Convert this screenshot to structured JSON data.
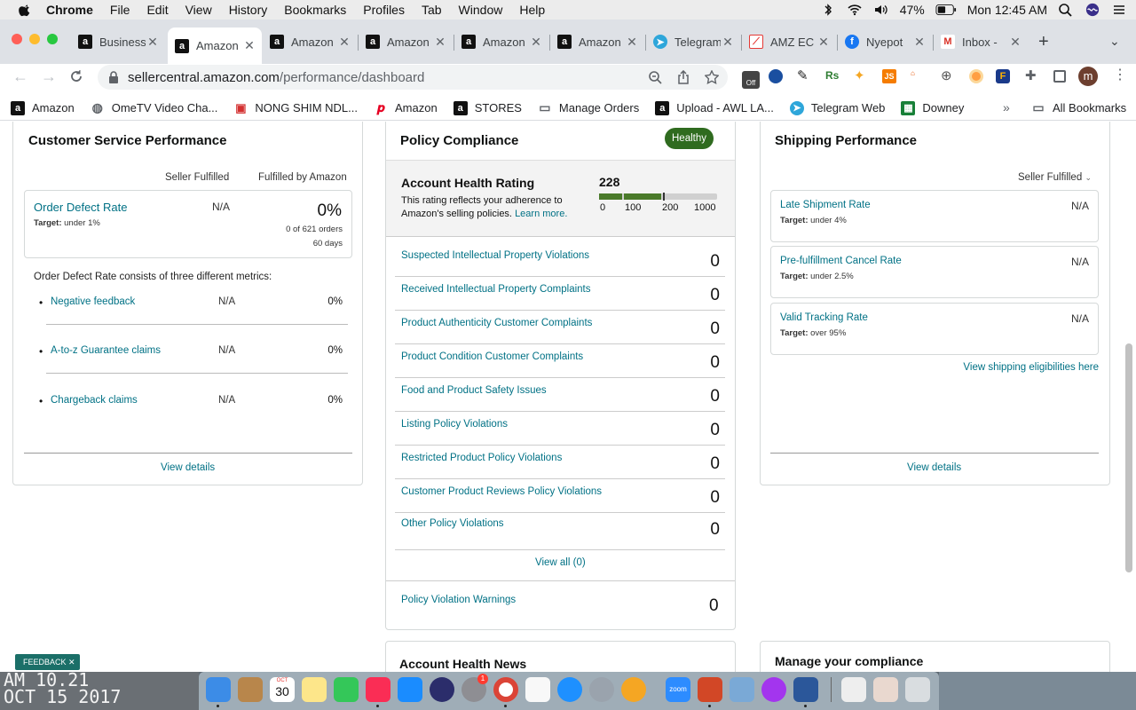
{
  "menubar": {
    "items": [
      "Chrome",
      "File",
      "Edit",
      "View",
      "History",
      "Bookmarks",
      "Profiles",
      "Tab",
      "Window",
      "Help"
    ],
    "battery": "47%",
    "clock": "Mon 12:45 AM"
  },
  "tabs": [
    {
      "title": "Business",
      "icon": "amazon-icon"
    },
    {
      "title": "Amazon",
      "icon": "amazon-icon"
    },
    {
      "title": "Amazon",
      "icon": "amazon-icon"
    },
    {
      "title": "Amazon",
      "icon": "amazon-icon"
    },
    {
      "title": "Amazon",
      "icon": "amazon-icon"
    },
    {
      "title": "Amazon",
      "icon": "amazon-icon"
    },
    {
      "title": "Telegram",
      "icon": "telegram-icon"
    },
    {
      "title": "AMZ EC",
      "icon": "amz-icon"
    },
    {
      "title": "Nyepot",
      "icon": "facebook-icon"
    },
    {
      "title": "Inbox -",
      "icon": "gmail-icon"
    }
  ],
  "address": {
    "domain": "sellercentral.amazon.com",
    "path": "/performance/dashboard"
  },
  "profile_initial": "m",
  "bookmarks": [
    {
      "label": "Amazon",
      "icon": "amazon-icon"
    },
    {
      "label": "OmeTV Video Cha...",
      "icon": "globe-icon"
    },
    {
      "label": "NONG SHIM NDL...",
      "icon": "gift-icon"
    },
    {
      "label": "Amazon",
      "icon": "pinterest-icon"
    },
    {
      "label": "STORES",
      "icon": "amazon-icon"
    },
    {
      "label": "Manage Orders",
      "icon": "folder-icon"
    },
    {
      "label": "Upload - AWL LA...",
      "icon": "amazon-icon"
    },
    {
      "label": "Telegram Web",
      "icon": "telegram-icon"
    },
    {
      "label": "Downey",
      "icon": "sheets-icon"
    }
  ],
  "bookmarks_more": "»",
  "all_bookmarks": "All Bookmarks",
  "customer_service": {
    "title": "Customer Service Performance",
    "col1": "Seller Fulfilled",
    "col2": "Fulfilled by Amazon",
    "odr": {
      "label": "Order Defect Rate",
      "target_label": "Target:",
      "target": "under 1%",
      "seller": "N/A",
      "fba": "0%",
      "orders": "0 of 621 orders",
      "days": "60 days"
    },
    "consists": "Order Defect Rate consists of three different metrics:",
    "metrics": [
      {
        "label": "Negative feedback",
        "seller": "N/A",
        "fba": "0%"
      },
      {
        "label": "A-to-z Guarantee claims",
        "seller": "N/A",
        "fba": "0%"
      },
      {
        "label": "Chargeback claims",
        "seller": "N/A",
        "fba": "0%"
      }
    ],
    "view_details": "View details"
  },
  "policy": {
    "title": "Policy Compliance",
    "badge": "Healthy",
    "badge_color": "#2f6b1f",
    "ahr_title": "Account Health Rating",
    "ahr_desc_1": "This rating reflects your adherence to",
    "ahr_desc_2": "Amazon's selling policies.",
    "learn_more": "Learn more.",
    "score": "228",
    "score_fraction": 0.228,
    "scale": [
      "0",
      "100",
      "200",
      "1000"
    ],
    "rows": [
      {
        "label": "Suspected Intellectual Property Violations",
        "value": "0"
      },
      {
        "label": "Received Intellectual Property Complaints",
        "value": "0"
      },
      {
        "label": "Product Authenticity Customer Complaints",
        "value": "0"
      },
      {
        "label": "Product Condition Customer Complaints",
        "value": "0"
      },
      {
        "label": "Food and Product Safety Issues",
        "value": "0"
      },
      {
        "label": "Listing Policy Violations",
        "value": "0"
      },
      {
        "label": "Restricted Product Policy Violations",
        "value": "0"
      },
      {
        "label": "Customer Product Reviews Policy Violations",
        "value": "0"
      },
      {
        "label": "Other Policy Violations",
        "value": "0"
      }
    ],
    "view_all": "View all (0)",
    "warnings_label": "Policy Violation Warnings",
    "warnings_value": "0",
    "news_title": "Account Health News"
  },
  "shipping": {
    "title": "Shipping Performance",
    "filter": "Seller Fulfilled",
    "metrics": [
      {
        "label": "Late Shipment Rate",
        "target_label": "Target:",
        "target": "under 4%",
        "value": "N/A"
      },
      {
        "label": "Pre-fulfillment Cancel Rate",
        "target_label": "Target:",
        "target": "under 2.5%",
        "value": "N/A"
      },
      {
        "label": "Valid Tracking Rate",
        "target_label": "Target:",
        "target": "over 95%",
        "value": "N/A"
      }
    ],
    "eligibility_link": "View shipping eligibilities here",
    "view_details": "View details",
    "manage_title": "Manage your compliance"
  },
  "feedback": "FEEDBACK",
  "desktop_text_1": "AM 10.21",
  "desktop_text_2": "OCT 15 2017",
  "dock_calendar_month": "OCT",
  "dock_calendar_day": "30",
  "dock_badge": "1",
  "dock_zoom": "zoom"
}
